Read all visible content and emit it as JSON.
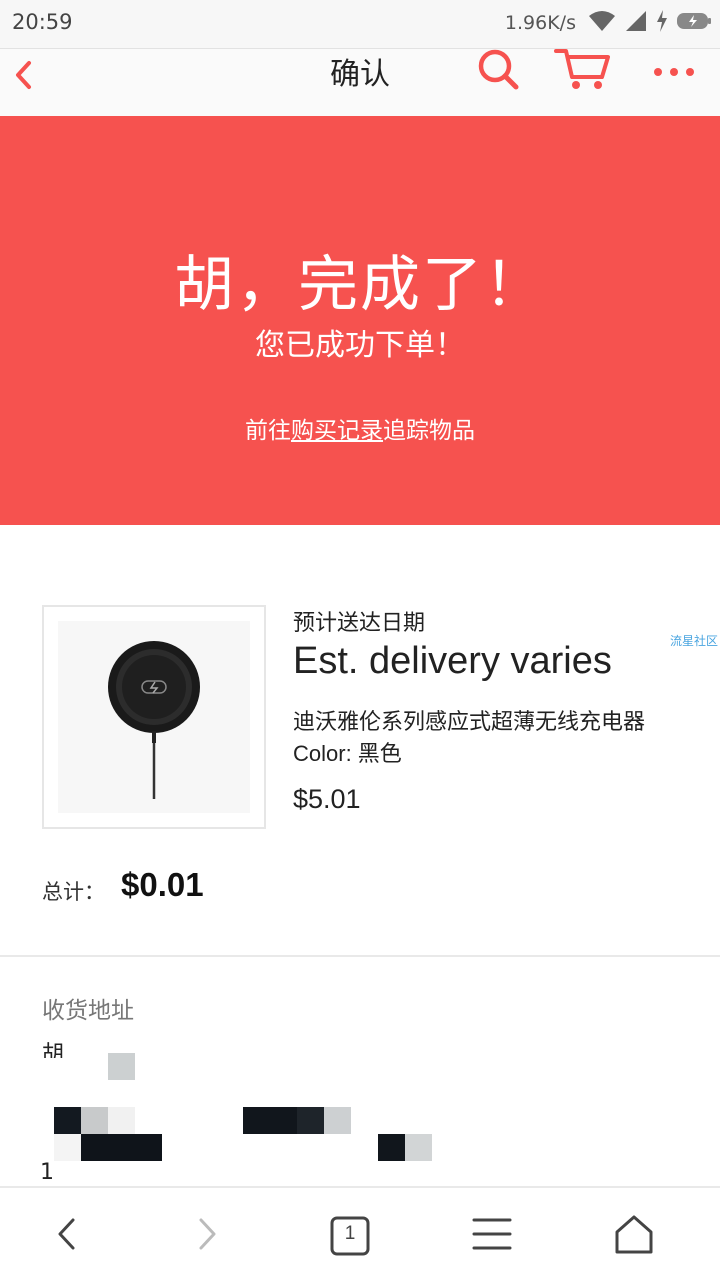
{
  "status_bar": {
    "time": "20:59",
    "network_speed": "1.96K/s"
  },
  "header": {
    "title": "确认",
    "icons": [
      "back-chevron-icon",
      "search-icon",
      "cart-icon",
      "more-dots-icon"
    ],
    "accent_color": "#f6524f"
  },
  "banner": {
    "title": "胡，完成了！",
    "subtitle": "您已成功下单！",
    "link_prefix": "前往",
    "link_text": "购买记录",
    "link_suffix": "追踪物品",
    "background_color": "#f6524f"
  },
  "order": {
    "delivery_label": "预计送达日期",
    "delivery_value": "Est. delivery varies",
    "side_tag": "流星社区",
    "product_name": "迪沃雅伦系列感应式超薄无线充电器",
    "product_color": "Color: 黑色",
    "product_price": "$5.01",
    "total_label": "总计：",
    "total_value": "$0.01"
  },
  "address": {
    "label": "收货地址",
    "fragment_1": "胡",
    "fragment_2": "1"
  },
  "bottom_nav": {
    "tab_count": "1",
    "icons": [
      "nav-back-icon",
      "nav-forward-icon",
      "tabs-icon",
      "menu-icon",
      "home-icon"
    ]
  }
}
